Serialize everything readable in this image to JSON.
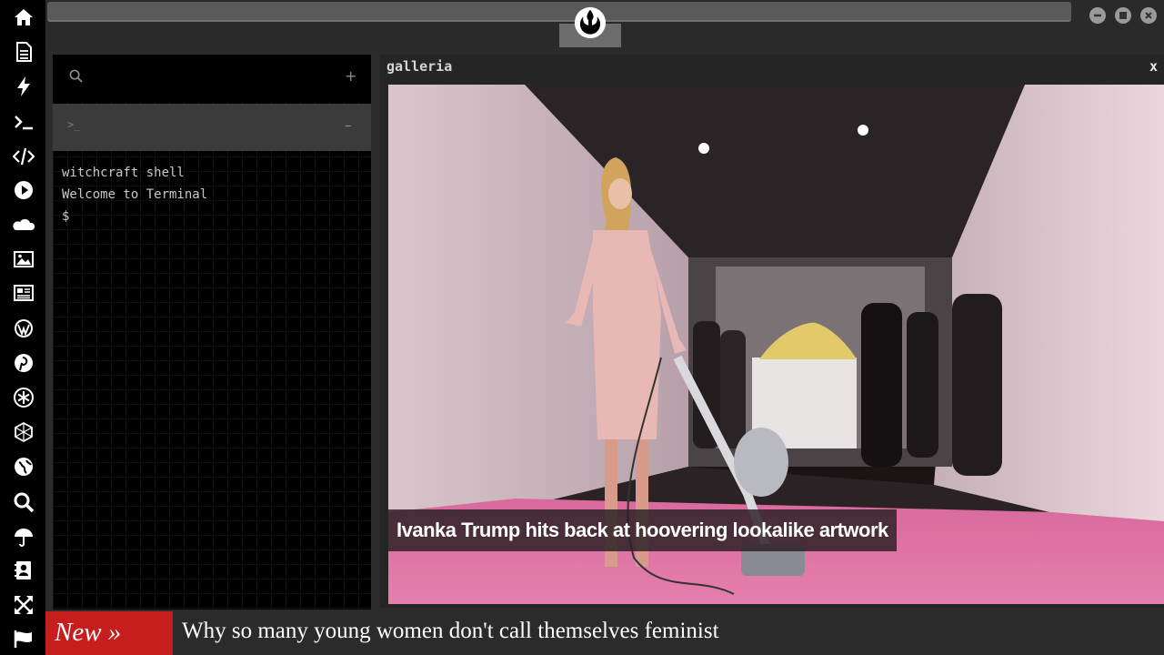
{
  "sidebar": {
    "icons": [
      "home-icon",
      "document-icon",
      "bolt-icon",
      "terminal-icon",
      "code-icon",
      "play-icon",
      "cloud-icon",
      "image-icon",
      "newspaper-icon",
      "wordpress-icon",
      "pinterest-icon",
      "asterisk-icon",
      "network-icon",
      "globe-icon",
      "search-icon",
      "umbrella-icon",
      "contact-icon",
      "expand-icon",
      "flag-icon"
    ]
  },
  "topbar": {
    "logo": "rebel-alliance-logo",
    "window_buttons": [
      "minimize",
      "maximize",
      "close"
    ]
  },
  "terminal": {
    "search_icon": "search-icon",
    "add_label": "+",
    "prompt_glyph": ">_",
    "collapse_label": "–",
    "lines": [
      "witchcraft shell",
      "Welcome to Terminal",
      "$"
    ]
  },
  "gallery": {
    "title": "galleria",
    "close_label": "x",
    "caption": "Ivanka Trump hits back at hoovering lookalike artwork"
  },
  "ticker": {
    "badge": "New »",
    "headline": "Why so many young women don't call themselves feminist"
  },
  "colors": {
    "ticker_badge": "#c61d1d",
    "panel_bg": "#2b2b2b",
    "terminal_bg": "#000000"
  }
}
